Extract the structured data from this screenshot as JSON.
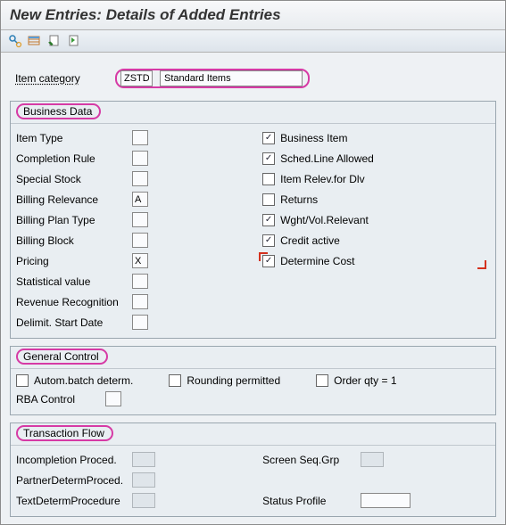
{
  "title": "New Entries: Details of Added Entries",
  "itemcat": {
    "label": "Item category",
    "code": "ZSTD",
    "desc": "Standard Items"
  },
  "bd": {
    "header": "Business Data",
    "left": {
      "item_type": "Item Type",
      "item_type_v": "",
      "comp_rule": "Completion Rule",
      "comp_rule_v": "",
      "spec_stock": "Special Stock",
      "spec_stock_v": "",
      "bill_rel": "Billing Relevance",
      "bill_rel_v": "A",
      "bill_plan": "Billing Plan Type",
      "bill_plan_v": "",
      "bill_block": "Billing Block",
      "bill_block_v": "",
      "pricing": "Pricing",
      "pricing_v": "X",
      "stat_val": "Statistical value",
      "stat_val_v": "",
      "rev_rec": "Revenue Recognition",
      "rev_rec_v": "",
      "delim": "Delimit. Start Date",
      "delim_v": ""
    },
    "right": {
      "business_item": "Business Item",
      "sched_line": "Sched.Line Allowed",
      "item_relev": "Item Relev.for Dlv",
      "returns": "Returns",
      "wght": "Wght/Vol.Relevant",
      "credit": "Credit active",
      "detcost": "Determine Cost"
    }
  },
  "gc": {
    "header": "General Control",
    "autom": "Autom.batch determ.",
    "round": "Rounding permitted",
    "orderqty": "Order qty = 1",
    "rba": "RBA Control"
  },
  "tf": {
    "header": "Transaction Flow",
    "incomp": "Incompletion Proced.",
    "partner": "PartnerDetermProced.",
    "textdet": "TextDetermProcedure",
    "screen": "Screen Seq.Grp",
    "status": "Status Profile"
  }
}
